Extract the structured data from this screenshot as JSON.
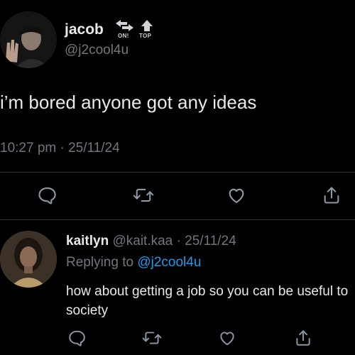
{
  "main_tweet": {
    "display_name": "jacob",
    "badge_left": "ON!",
    "badge_right": "TOP",
    "handle": "@j2cool4u",
    "text": "i’m bored anyone got any ideas",
    "timestamp": "10:27 pm · 25/11/24",
    "actions": {
      "reply_icon": "reply-icon",
      "retweet_icon": "retweet-icon",
      "like_icon": "heart-icon",
      "share_icon": "share-icon"
    }
  },
  "reply": {
    "display_name": "kaitlyn",
    "handle": "@kait.kaa",
    "separator": " · ",
    "date": "25/11/24",
    "replying_prefix": "Replying to ",
    "replying_handle": "@j2cool4u",
    "text": "how about getting a job so you can be useful to society"
  },
  "colors": {
    "background": "#000000",
    "text": "#e7e9ea",
    "muted": "#71767b",
    "link": "#1d9bf0",
    "divider": "#2f3336"
  }
}
